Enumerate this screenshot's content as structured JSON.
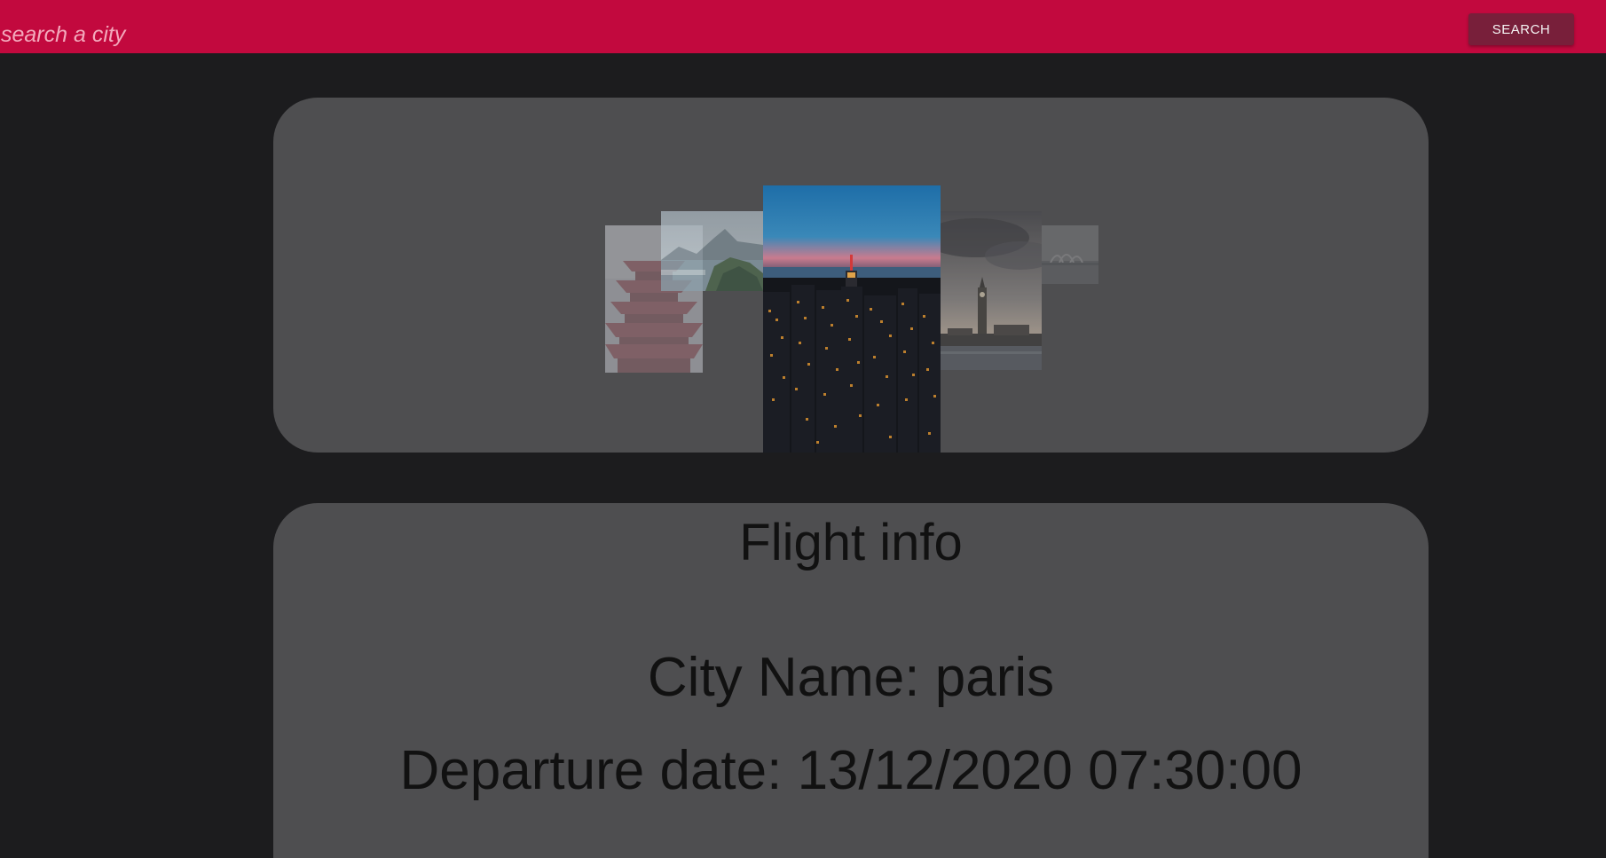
{
  "header": {
    "search_placeholder": "search a city",
    "search_button_label": "SEARCH",
    "bar_color": "#c2093e"
  },
  "carousel": {
    "slides": [
      {
        "name": "pagoda",
        "active": false
      },
      {
        "name": "coastal-mountain",
        "active": false
      },
      {
        "name": "skyline-night",
        "active": true
      },
      {
        "name": "clock-tower-city",
        "active": false
      },
      {
        "name": "harbour-city",
        "active": false
      }
    ]
  },
  "flight_info": {
    "title": "Flight info",
    "city_label": "City Name:",
    "city_value": "paris",
    "city_text": "City Name: paris",
    "departure_label": "Departure date:",
    "departure_value": "13/12/2020 07:30:00",
    "departure_text": "Departure date: 13/12/2020 07:30:00"
  }
}
